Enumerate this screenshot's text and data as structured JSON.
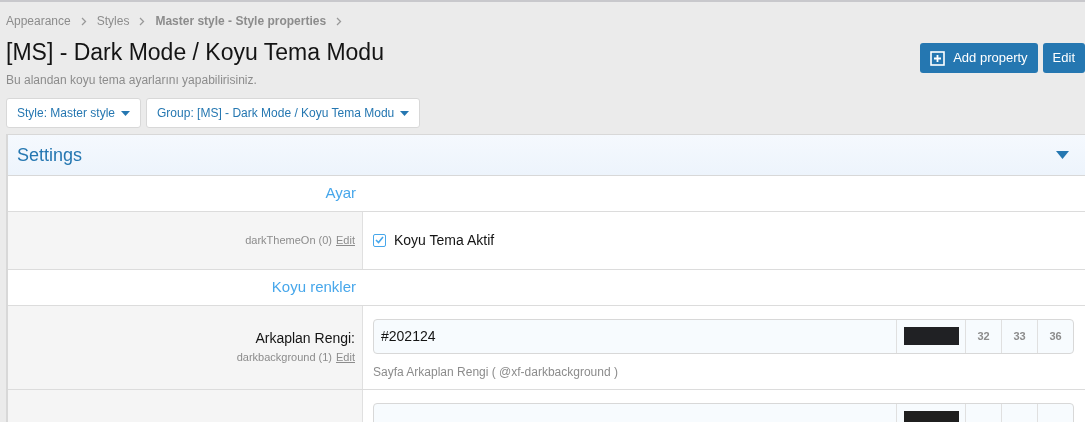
{
  "breadcrumbs": [
    {
      "label": "Appearance",
      "current": false
    },
    {
      "label": "Styles",
      "current": false
    },
    {
      "label": "Master style - Style properties",
      "current": true
    }
  ],
  "title": "[MS] - Dark Mode / Koyu Tema Modu",
  "description": "Bu alandan koyu tema ayarlarını yapabilirisiniz.",
  "actions": [
    {
      "label": "Add property",
      "kind": "add"
    },
    {
      "label": "Edit",
      "kind": "plain"
    }
  ],
  "filters": [
    "Style: Master style",
    "Group: [MS] - Dark Mode / Koyu Tema Modu"
  ],
  "panel": {
    "title": "Settings",
    "expanded": true,
    "sections": [
      {
        "heading": "Ayar",
        "rows": [
          {
            "kind": "checkbox",
            "meta": "darkThemeOn (0)",
            "edit": "Edit",
            "label": "Koyu Tema Aktif",
            "checked": true
          }
        ]
      },
      {
        "heading": "Koyu renkler",
        "rows": [
          {
            "kind": "color",
            "label": "Arkaplan Rengi:",
            "meta": "darkbackground (1)",
            "edit": "Edit",
            "value": "#202124",
            "color": "#202124",
            "rgb": [
              "32",
              "33",
              "36"
            ],
            "hint": "Sayfa Arkaplan Rengi ( @xf-darkbackground )"
          },
          {
            "kind": "color",
            "color": "#1f1f1f"
          }
        ]
      }
    ]
  }
}
